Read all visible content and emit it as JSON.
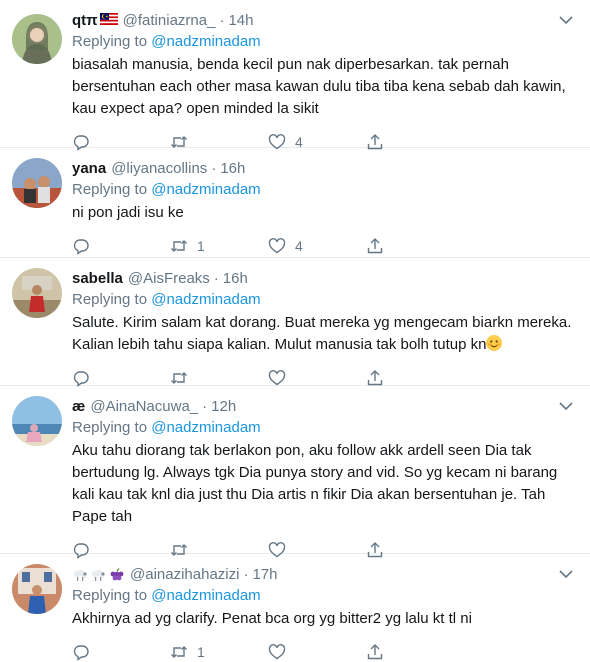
{
  "tweets": [
    {
      "name": "qtπ",
      "handle": "@fatiniazrna_",
      "time": "14h",
      "replying_prefix": "Replying to",
      "replying_to": "@nadzminadam",
      "text": "biasalah manusia, benda kecil pun nak diperbesarkan. tak pernah bersentuhan each other masa kawan dulu tiba tiba kena sebab dah kawin, kau expect apa? open minded la sikit",
      "reply_count": "",
      "retweet_count": "",
      "like_count": "4"
    },
    {
      "name": "yana",
      "handle": "@liyanacollins",
      "time": "16h",
      "replying_prefix": "Replying to",
      "replying_to": "@nadzminadam",
      "text": "ni pon jadi isu ke",
      "reply_count": "",
      "retweet_count": "1",
      "like_count": "4"
    },
    {
      "name": "sabella",
      "handle": "@AisFreaks",
      "time": "16h",
      "replying_prefix": "Replying to",
      "replying_to": "@nadzminadam",
      "text": "Salute. Kirim salam kat dorang. Buat mereka yg mengecam biarkn mereka. Kalian lebih tahu siapa kalian. Mulut manusia tak bolh tutup kn",
      "reply_count": "",
      "retweet_count": "",
      "like_count": ""
    },
    {
      "name": "æ",
      "handle": "@AinaNacuwa_",
      "time": "12h",
      "replying_prefix": "Replying to",
      "replying_to": "@nadzminadam",
      "text": "Aku tahu diorang tak berlakon pon, aku follow akk ardell seen Dia tak bertudung lg. Always tgk Dia punya story and vid. So yg kecam ni barang kali kau tak knl dia just thu Dia artis n fikir Dia akan bersentuhan je. Tah Pape tah",
      "reply_count": "",
      "retweet_count": "",
      "like_count": ""
    },
    {
      "name": "",
      "handle": "@ainazihahazizi",
      "time": "17h",
      "replying_prefix": "Replying to",
      "replying_to": "@nadzminadam",
      "text": "Akhirnya ad yg clarify. Penat bca org yg bitter2 yg lalu kt tl ni",
      "reply_count": "",
      "retweet_count": "1",
      "like_count": ""
    }
  ],
  "separator": "·",
  "colors": {
    "text": "#14171a",
    "muted": "#657786",
    "link": "#1b95e0",
    "border": "#e6ecf0"
  },
  "icons": [
    "reply-icon",
    "retweet-icon",
    "like-icon",
    "share-icon",
    "caret-down-icon"
  ]
}
